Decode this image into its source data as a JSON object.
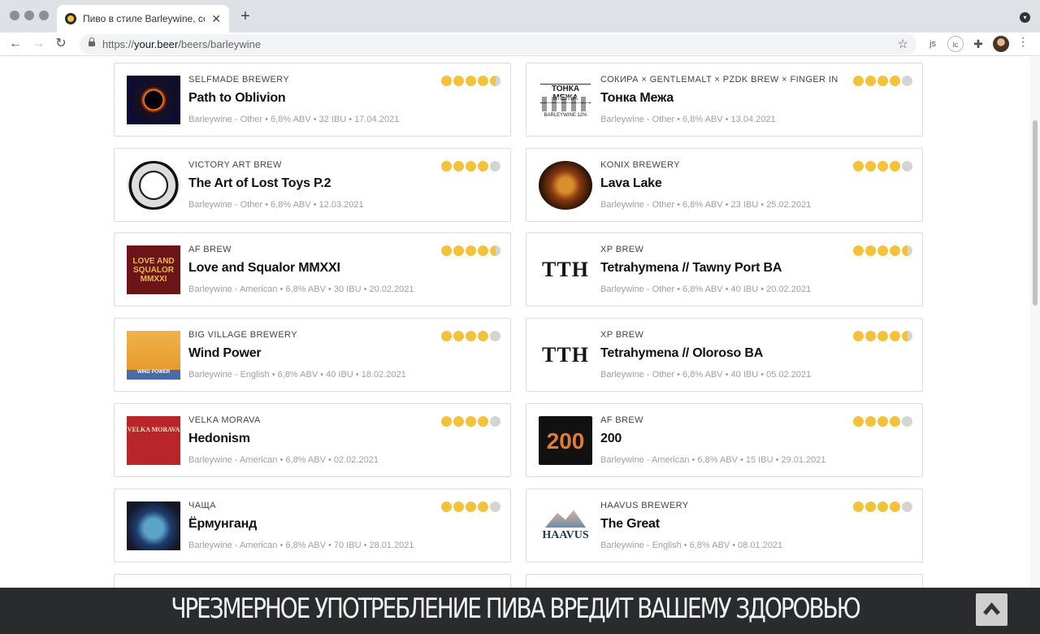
{
  "browser": {
    "tab_title": "Пиво в стиле Barleywine, сор",
    "url_prefix": "https://",
    "url_domain": "your.beer",
    "url_path": "/beers/barleywine",
    "ext_js_label": "js",
    "ext_2_label": "lc"
  },
  "beers": [
    {
      "brewery": "SELFMADE BREWERY",
      "name": "Path to Oblivion",
      "meta": "Barleywine - Other • 6,8% ABV • 32 IBU • 17.04.2021",
      "rating": 4.3,
      "thumb": "eclipse"
    },
    {
      "brewery": "СОКИРА × GENTLEMALT × PZDK BREW × FINGER IN",
      "name": "Тонка Межа",
      "meta": "Barleywine - Other • 6,8% ABV • 13.04.2021",
      "rating": 4.0,
      "thumb": "tonka",
      "thumb_text": "ТОНКА МЕЖА",
      "thumb_sub": "BARLEYWINE 12%"
    },
    {
      "brewery": "VICTORY ART BREW",
      "name": "The Art of Lost Toys P.2",
      "meta": "Barleywine - Other • 6,8% ABV • 12.03.2021",
      "rating": 4.0,
      "thumb": "victory"
    },
    {
      "brewery": "KONIX BREWERY",
      "name": "Lava Lake",
      "meta": "Barleywine - Other • 6,8% ABV • 23 IBU • 25.02.2021",
      "rating": 4.0,
      "thumb": "lava"
    },
    {
      "brewery": "AF BREW",
      "name": "Love and Squalor MMXXI",
      "meta": "Barleywine - American • 6,8% ABV • 30 IBU • 20.02.2021",
      "rating": 4.5,
      "thumb": "loveq",
      "thumb_text": "LOVE AND SQUALOR MMXXI"
    },
    {
      "brewery": "XP BREW",
      "name": "Tetrahymena // Tawny Port BA",
      "meta": "Barleywine - Other • 6,8% ABV • 40 IBU • 20.02.2021",
      "rating": 4.5,
      "thumb": "tth",
      "thumb_text": "TTH"
    },
    {
      "brewery": "BIG VILLAGE BREWERY",
      "name": "Wind Power",
      "meta": "Barleywine - English • 6,8% ABV • 40 IBU • 18.02.2021",
      "rating": 4.0,
      "thumb": "wind",
      "thumb_text": "WIND POWER"
    },
    {
      "brewery": "XP BREW",
      "name": "Tetrahymena // Oloroso BA",
      "meta": "Barleywine - Other • 6,8% ABV • 40 IBU • 05.02.2021",
      "rating": 4.5,
      "thumb": "tth",
      "thumb_text": "TTH"
    },
    {
      "brewery": "VELKA MORAVA",
      "name": "Hedonism",
      "meta": "Barleywine - American • 6,8% ABV • 02.02.2021",
      "rating": 4.0,
      "thumb": "velka",
      "thumb_text": "VELKA MORAVA"
    },
    {
      "brewery": "AF BREW",
      "name": "200",
      "meta": "Barleywine - American • 6,8% ABV • 15 IBU • 29.01.2021",
      "rating": 4.0,
      "thumb": "200",
      "thumb_text": "200"
    },
    {
      "brewery": "ЧАЩА",
      "name": "Ёрмунганд",
      "meta": "Barleywine - American • 6,8% ABV • 70 IBU • 28.01.2021",
      "rating": 4.0,
      "thumb": "chasha"
    },
    {
      "brewery": "HAAVUS BREWERY",
      "name": "The Great",
      "meta": "Barleywine - English • 6,8% ABV • 08.01.2021",
      "rating": 4.0,
      "thumb": "haavus",
      "thumb_text": "HAAVUS"
    }
  ],
  "warning_banner": "ЧРЕЗМЕРНОЕ УПОТРЕБЛЕНИЕ ПИВА ВРЕДИТ ВАШЕМУ ЗДОРОВЬЮ",
  "colors": {
    "rating_on": "#f4c23a",
    "rating_off": "#d4d4d4",
    "banner_bg": "#292b2d"
  }
}
